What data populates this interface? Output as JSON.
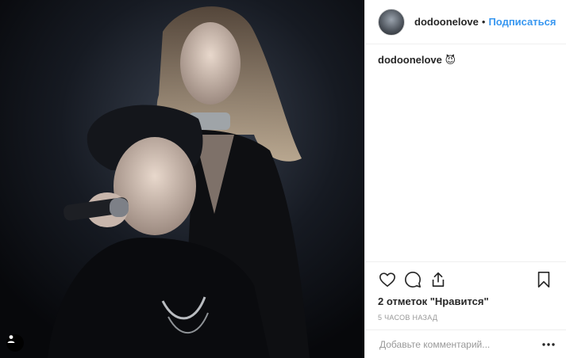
{
  "post": {
    "author": {
      "username": "dodoonelove",
      "separator": "•",
      "follow_label": "Подписаться"
    },
    "caption": {
      "username": "dodoonelove",
      "text": " 😈"
    },
    "likes_text": "2 отметок \"Нравится\"",
    "timestamp": "5 часов назад",
    "comment": {
      "placeholder": "Добавьте комментарий...",
      "value": ""
    },
    "icons": {
      "like": "heart-icon",
      "comment": "speech-bubble-icon",
      "share": "share-icon",
      "save": "bookmark-icon",
      "more": "more-options-icon",
      "tag": "user-tag-icon"
    },
    "colors": {
      "accent": "#3897f0",
      "muted": "#999999",
      "text": "#262626"
    }
  }
}
